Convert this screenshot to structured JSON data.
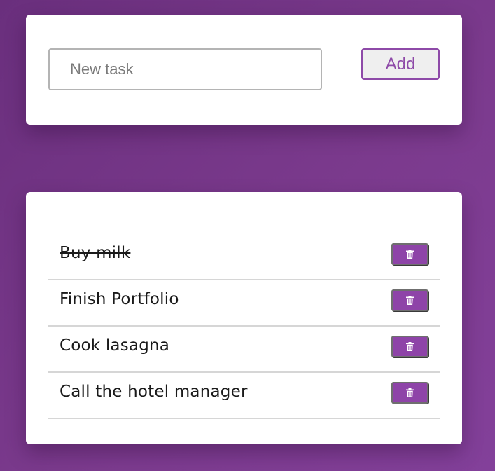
{
  "input_form": {
    "placeholder": "New task",
    "value": "",
    "add_label": "Add"
  },
  "tasks": [
    {
      "text": "Buy milk",
      "completed": true
    },
    {
      "text": "Finish Portfolio",
      "completed": false
    },
    {
      "text": "Cook lasagna",
      "completed": false
    },
    {
      "text": "Call the hotel manager",
      "completed": false
    }
  ],
  "icons": {
    "delete": "trash-icon"
  },
  "colors": {
    "background": "#7b3a8d",
    "accent": "#8e44a8",
    "card": "#ffffff"
  }
}
